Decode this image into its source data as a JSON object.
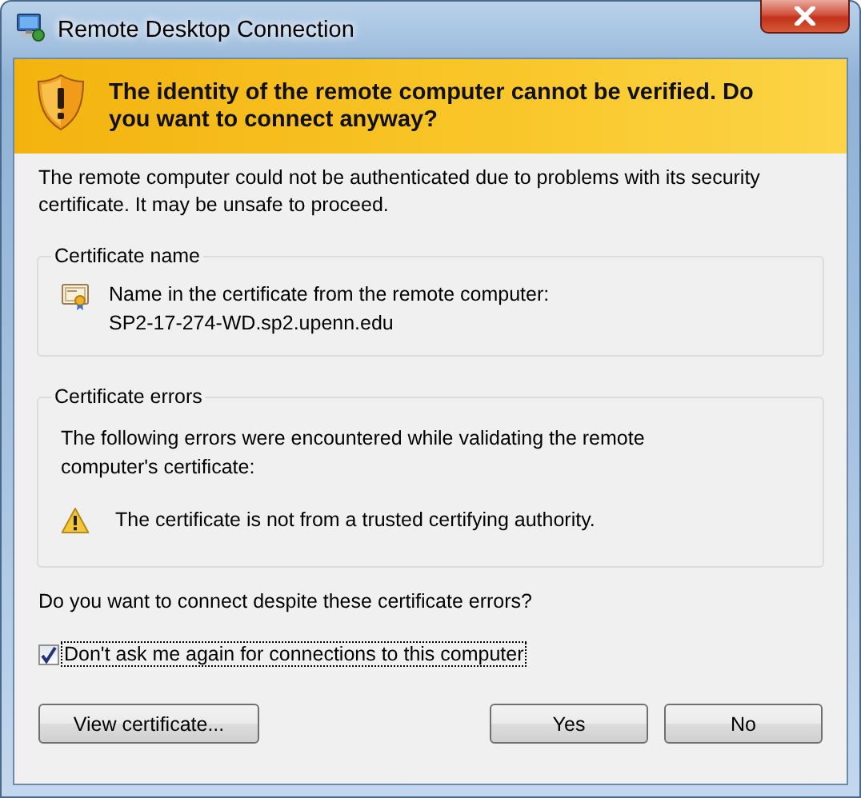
{
  "window": {
    "title": "Remote Desktop Connection"
  },
  "banner": {
    "message": "The identity of the remote computer cannot be verified. Do you want to connect anyway?"
  },
  "intro": "The remote computer could not be authenticated due to problems with its security certificate. It may be unsafe to proceed.",
  "groups": [
    {
      "kind": "name",
      "title": "Certificate name",
      "label": "Name in the certificate from the remote computer:",
      "value": "SP2-17-274-WD.sp2.upenn.edu"
    },
    {
      "kind": "errors",
      "title": "Certificate errors",
      "intro": "The following errors were encountered while validating the remote computer's certificate:",
      "errors": [
        "The certificate is not from a trusted certifying authority."
      ]
    }
  ],
  "question": "Do you want to connect despite these certificate errors?",
  "checkbox": {
    "label": "Don't ask me again for connections to this computer",
    "checked": true
  },
  "left_buttons": [
    {
      "label": "View certificate..."
    }
  ],
  "right_buttons": [
    {
      "label": "Yes"
    },
    {
      "label": "No"
    }
  ]
}
